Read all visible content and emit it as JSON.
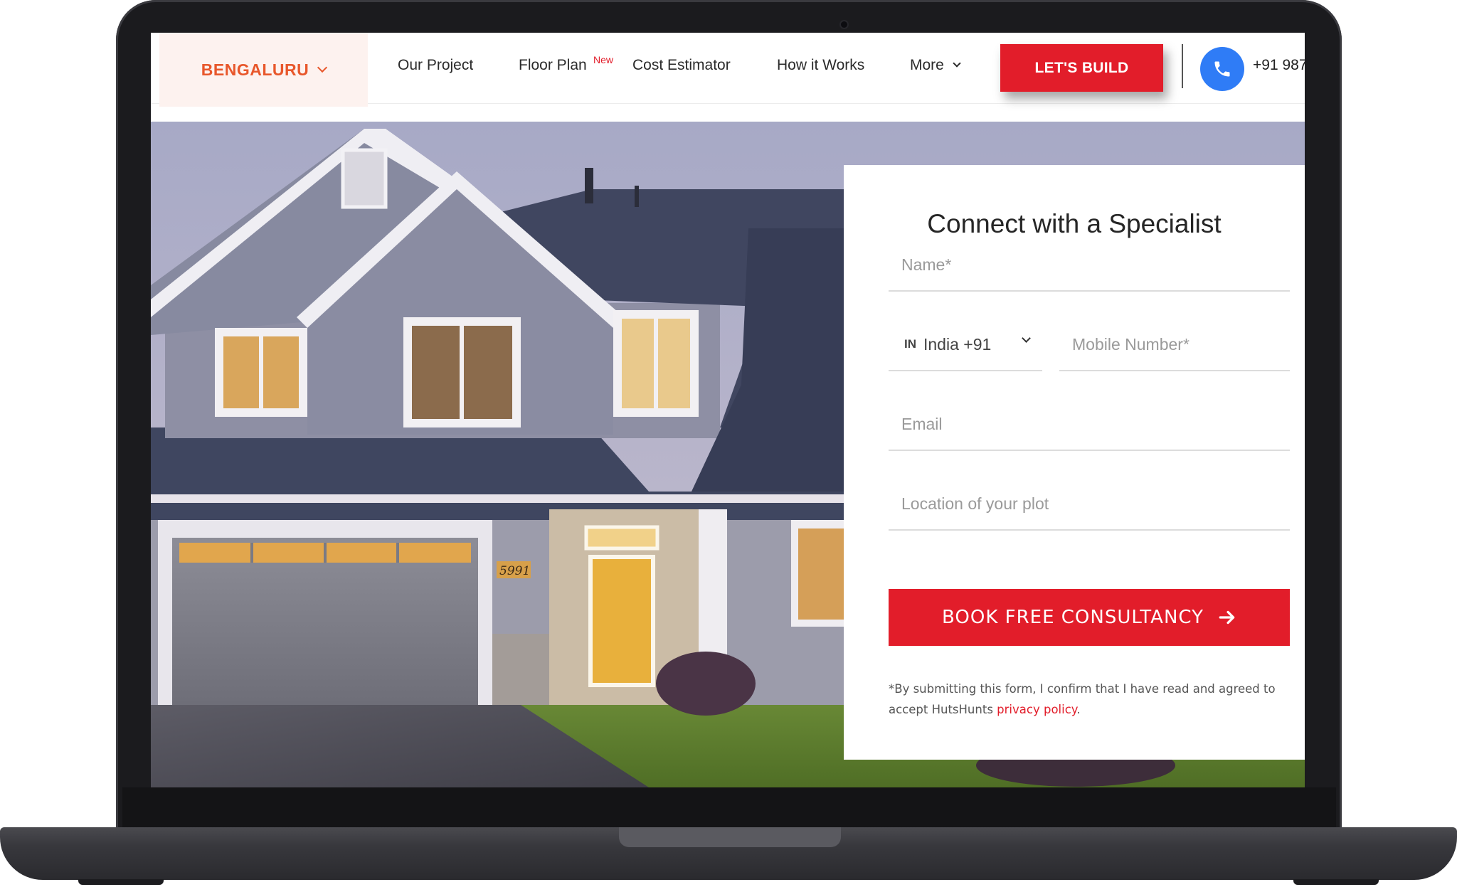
{
  "header": {
    "city": "BENGALURU",
    "nav": [
      {
        "label": "Our Project"
      },
      {
        "label": "Floor Plan",
        "badge": "New"
      },
      {
        "label": "Cost Estimator"
      },
      {
        "label": "How it Works"
      },
      {
        "label": "More"
      }
    ],
    "cta_label": "LET'S BUILD",
    "phone": "+91 987"
  },
  "hero": {
    "house_number": "5991"
  },
  "form": {
    "title": "Connect with a Specialist",
    "name_placeholder": "Name*",
    "country_code": "IN",
    "country_label": "India +91",
    "mobile_placeholder": "Mobile Number*",
    "email_placeholder": "Email",
    "location_placeholder": "Location of your plot",
    "submit_label": "BOOK FREE CONSULTANCY",
    "disclaimer_text": "*By submitting this form, I confirm that I have read and agreed to accept HutsHunts",
    "privacy_link": "privacy policy"
  },
  "colors": {
    "brand_red": "#e21d2a",
    "city_orange": "#e8572b",
    "phone_blue": "#2f7cf6"
  }
}
